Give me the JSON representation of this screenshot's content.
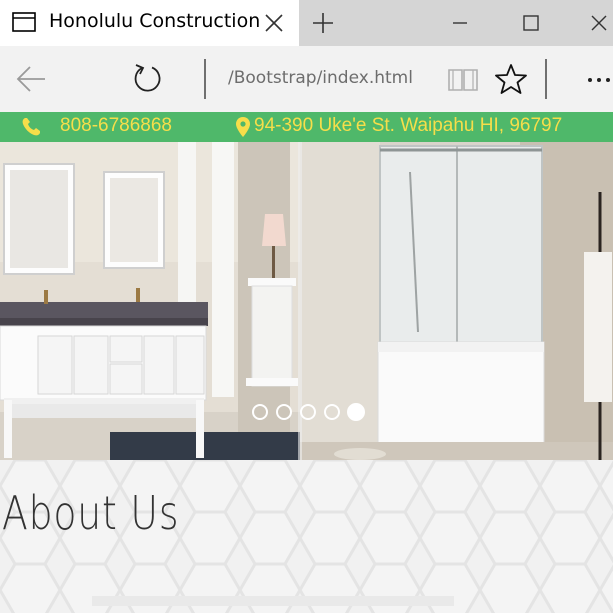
{
  "browser": {
    "tab_title": "Honolulu Construction",
    "url": "/Bootstrap/index.html",
    "icons": {
      "tab": "tab-page-icon",
      "tab_close": "close-icon",
      "new_tab": "plus-icon",
      "minimize": "minimize-icon",
      "maximize": "maximize-icon",
      "close": "close-icon",
      "back": "back-arrow-icon",
      "refresh": "refresh-icon",
      "reading_view": "book-icon",
      "favorite": "star-icon",
      "more": "more-dots-icon"
    }
  },
  "topbar": {
    "phone": "808-6786868",
    "address": "94-390 Uke'e St. Waipahu HI, 96797",
    "text_color": "#f6de4a",
    "background": "#4fb86a"
  },
  "carousel": {
    "slide_count": 5,
    "active_index": 4
  },
  "about": {
    "title": "About Us"
  }
}
